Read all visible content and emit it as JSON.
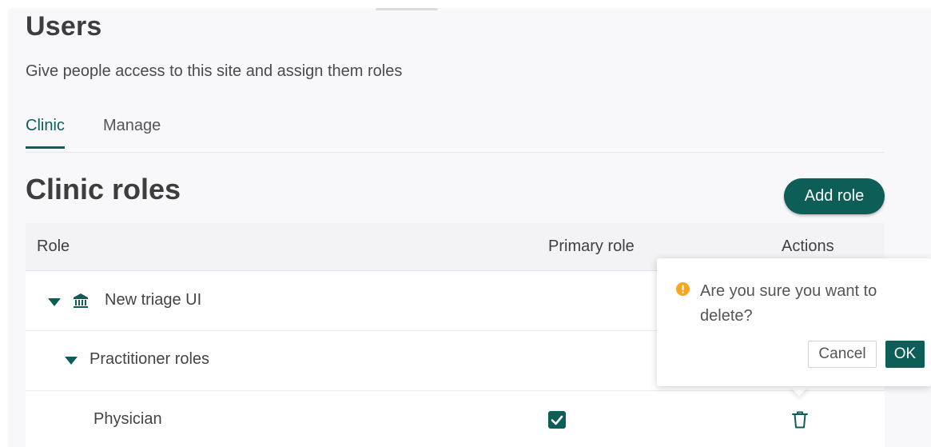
{
  "header": {
    "title": "Users",
    "subtitle": "Give people access to this site and assign them roles"
  },
  "tabs": [
    {
      "label": "Clinic",
      "active": true
    },
    {
      "label": "Manage",
      "active": false
    }
  ],
  "section": {
    "title": "Clinic roles",
    "add_button_label": "Add role"
  },
  "table": {
    "columns": [
      "Role",
      "Primary role",
      "Actions"
    ],
    "rows": [
      {
        "label": "New triage UI",
        "icon": "institution-icon",
        "expanded": true
      },
      {
        "label": "Practitioner roles",
        "expanded": true
      },
      {
        "label": "Physician",
        "primary_role_checked": true,
        "action_icon": "trash-icon"
      }
    ]
  },
  "confirm_popover": {
    "icon": "warning-icon",
    "message": "Are you sure you want to delete?",
    "cancel_label": "Cancel",
    "ok_label": "OK"
  },
  "colors": {
    "accent": "#0e5e58",
    "warning": "#f5a623",
    "panel_background": "#f8f8fa"
  }
}
